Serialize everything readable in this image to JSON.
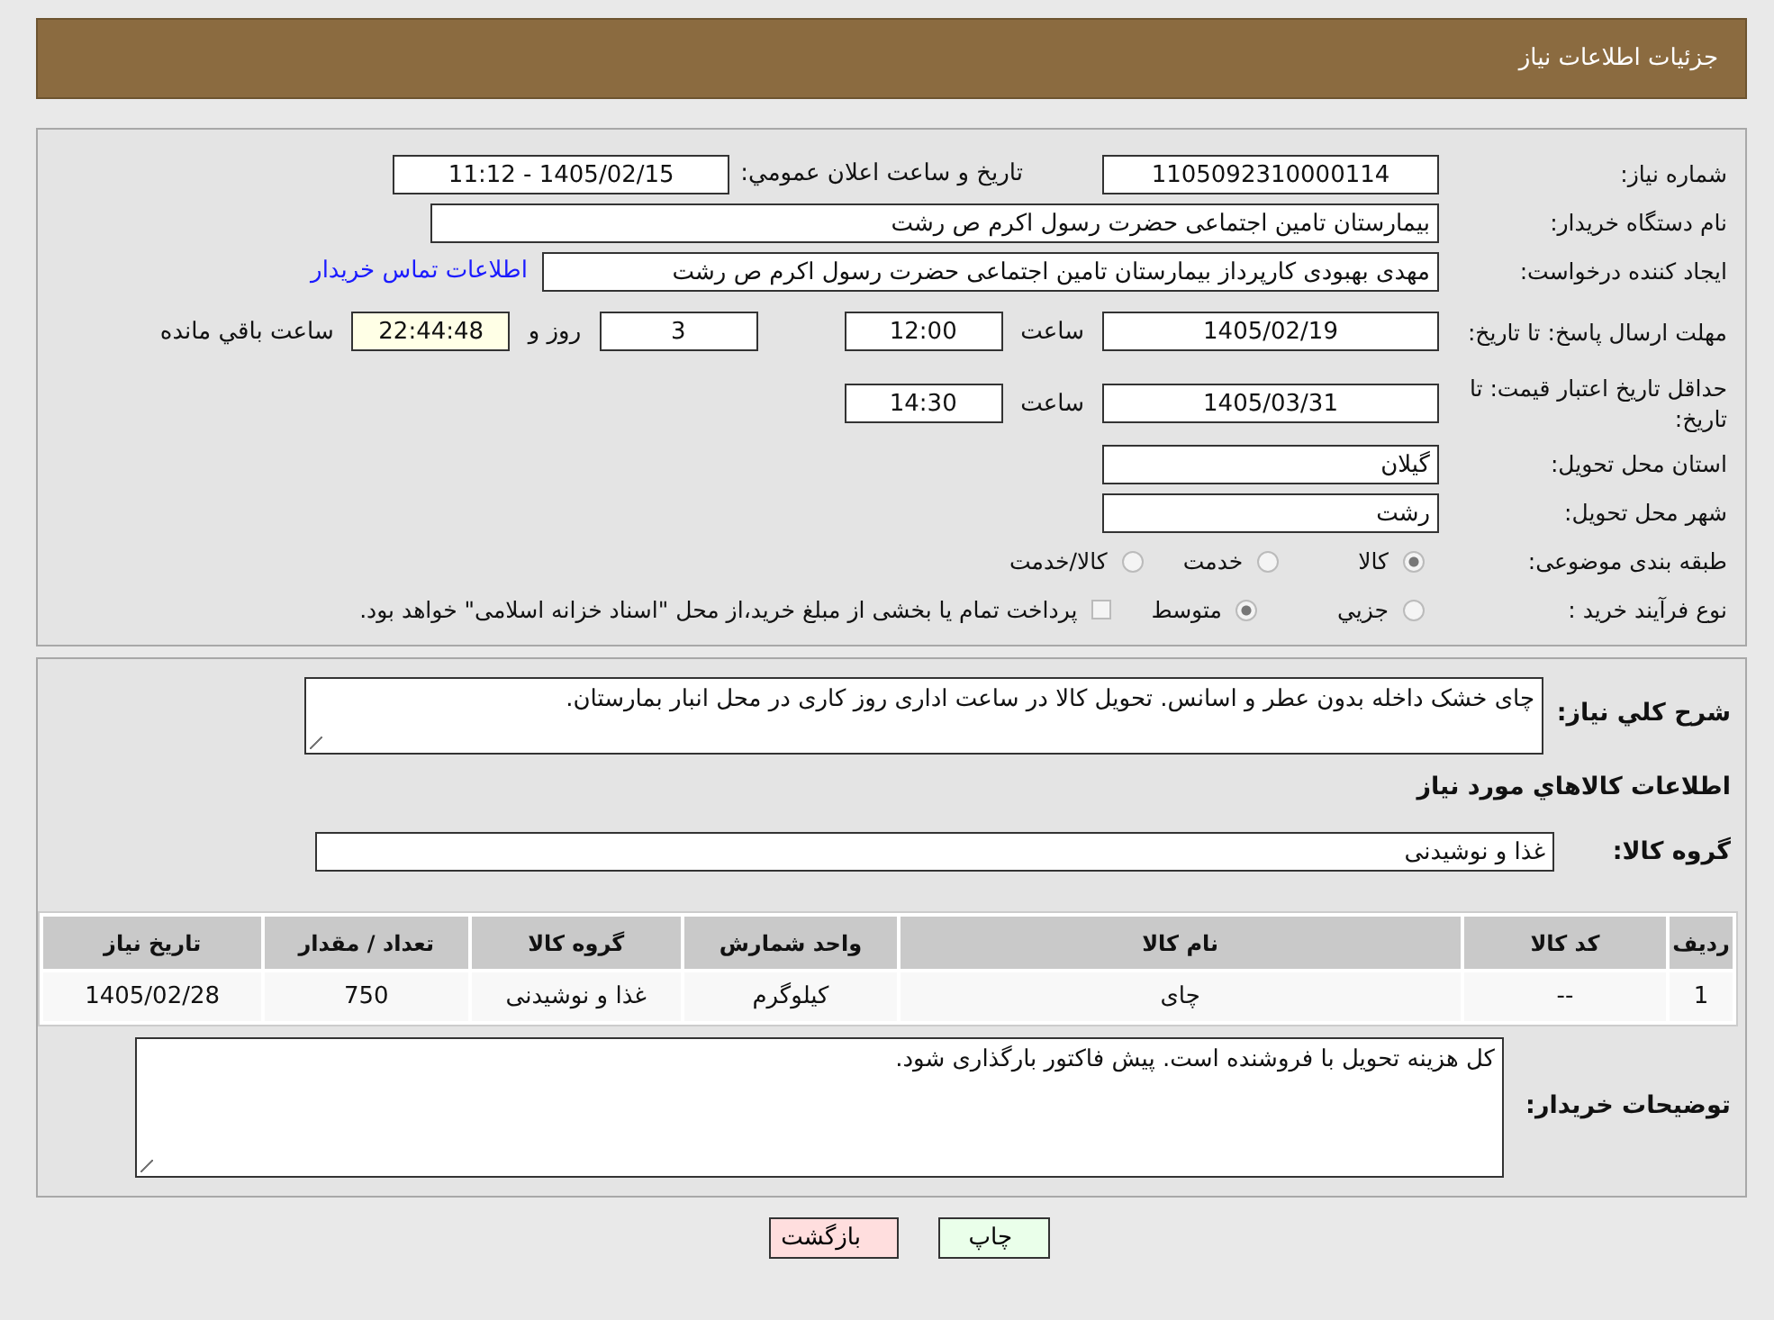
{
  "header": {
    "title": "جزئیات اطلاعات نیاز"
  },
  "form": {
    "need_number": {
      "label": "شماره نیاز:",
      "value": "1105092310000114"
    },
    "announce": {
      "label": "تاريخ و ساعت اعلان عمومي:",
      "value": "1405/02/15 - 11:12"
    },
    "buyer": {
      "label": "نام دستگاه خريدار:",
      "value": "بیمارستان  تامین اجتماعی حضرت رسول اکرم ص رشت"
    },
    "creator": {
      "label": "ایجاد کننده درخواست:",
      "value": "مهدی بهبودی کارپرداز بیمارستان  تامین اجتماعی حضرت رسول اکرم ص رشت",
      "link": "اطلاعات تماس خريدار"
    },
    "reply_deadline": {
      "label": "مهلت ارسال پاسخ: تا تاریخ:",
      "date": "1405/02/19",
      "time_label": "ساعت",
      "time": "12:00",
      "days": "3",
      "days_label": "روز و",
      "remaining": "22:44:48",
      "remaining_label": "ساعت باقي مانده"
    },
    "price_validity": {
      "label": "حداقل تاریخ اعتبار قیمت: تا تاریخ:",
      "date": "1405/03/31",
      "time_label": "ساعت",
      "time": "14:30"
    },
    "province": {
      "label": "استان محل تحویل:",
      "value": "گیلان"
    },
    "city": {
      "label": "شهر محل تحویل:",
      "value": "رشت"
    },
    "category": {
      "label": "طبقه بندی موضوعی:",
      "options": [
        {
          "label": "کالا",
          "selected": true
        },
        {
          "label": "خدمت",
          "selected": false
        },
        {
          "label": "کالا/خدمت",
          "selected": false
        }
      ]
    },
    "process": {
      "label": "نوع فرآیند خرید :",
      "options": [
        {
          "label": "جزيي",
          "selected": false
        },
        {
          "label": "متوسط",
          "selected": true
        }
      ],
      "treasury": {
        "label": "پرداخت تمام یا بخشی از مبلغ خرید،از محل \"اسناد خزانه اسلامی\" خواهد بود.",
        "checked": false
      }
    }
  },
  "details": {
    "description": {
      "label": "شرح کلي نياز:",
      "value": "چای خشک داخله بدون عطر و اسانس. تحویل کالا در ساعت اداری روز کاری در محل انبار بمارستان."
    },
    "goods_heading": "اطلاعات کالاهاي مورد نياز",
    "goods_group": {
      "label": "گروه کالا:",
      "value": "غذا و نوشیدنی"
    },
    "table": {
      "columns": [
        "ردیف",
        "کد کالا",
        "نام کالا",
        "واحد شمارش",
        "گروه کالا",
        "تعداد / مقدار",
        "تاریخ نیاز"
      ],
      "rows": [
        [
          "1",
          "--",
          "چای",
          "کیلوگرم",
          "غذا و نوشیدنی",
          "750",
          "1405/02/28"
        ]
      ]
    },
    "buyer_notes": {
      "label": "توضیحات خریدار:",
      "value": "کل هزینه تحویل با فروشنده است. پیش فاکتور بارگذاری شود."
    }
  },
  "buttons": [
    {
      "label": "چاپ",
      "kind": "print"
    },
    {
      "label": "بازگشت",
      "kind": "back"
    }
  ]
}
